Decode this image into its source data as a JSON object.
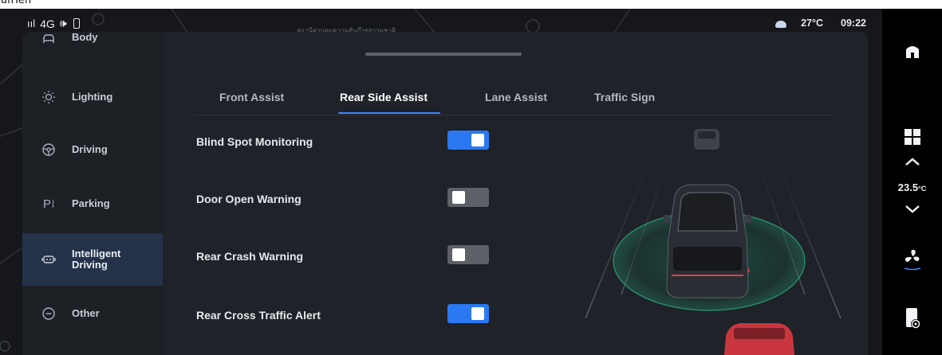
{
  "top_strip": {
    "text": "aflTeh"
  },
  "status_bar": {
    "network": "4G",
    "map_street_text": "สถานีควบคุมความดันก๊าซธรรมชาติ",
    "outside_temp": "27°C",
    "time": "09:22"
  },
  "sidebar": {
    "items": [
      {
        "label": "Body",
        "icon": "car-body-icon"
      },
      {
        "label": "Lighting",
        "icon": "sun-icon"
      },
      {
        "label": "Driving",
        "icon": "steering-wheel-icon"
      },
      {
        "label": "Parking",
        "icon": "parking-icon"
      },
      {
        "label": "Intelligent Driving",
        "line1": "Intelligent",
        "line2": "Driving",
        "icon": "intelligent-driving-icon",
        "active": true
      },
      {
        "label": "Other",
        "icon": "more-icon"
      }
    ]
  },
  "tabs": [
    {
      "label": "Front Assist"
    },
    {
      "label": "Rear Side Assist",
      "active": true
    },
    {
      "label": "Lane Assist"
    },
    {
      "label": "Traffic Sign"
    }
  ],
  "settings": [
    {
      "label": "Blind Spot Monitoring",
      "enabled": true
    },
    {
      "label": "Door Open Warning",
      "enabled": false
    },
    {
      "label": "Rear Crash Warning",
      "enabled": false
    },
    {
      "label": "Rear Cross Traffic Alert",
      "enabled": true
    }
  ],
  "dock": {
    "temp_value": "23.5",
    "temp_unit": "°C",
    "items": [
      "home-icon",
      "apps-grid-icon",
      "temp-up-icon",
      "temp-down-icon",
      "fan-icon",
      "phone-settings-icon"
    ]
  },
  "colors": {
    "accent": "#2a78f2",
    "panel": "#1f2228",
    "sidebar": "#1d2025",
    "sidebar_active": "#24324a",
    "toggle_off": "#5d6066",
    "radar_green": "#2bbf8a",
    "alert_red": "#e0404a"
  }
}
